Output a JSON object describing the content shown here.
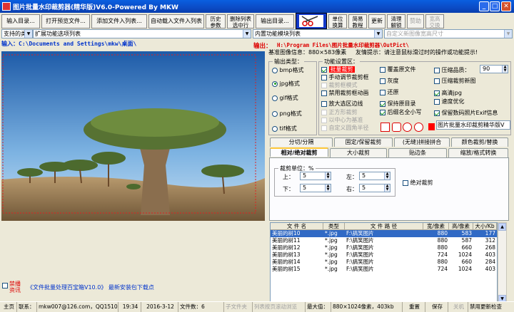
{
  "window": {
    "title": "图片批量水印裁剪器(精华版)V6.0-Powered By MKW"
  },
  "toolbar": {
    "input_dir": "输入目录...",
    "open_preview": "打开预览文件...",
    "add_files": "添加文件入列表...",
    "auto_load": "自动载入文件入列表",
    "history_1": "历史",
    "history_2": "参数",
    "delete_1": "删除列表",
    "delete_2": "选中行",
    "output_dir": "输出目录...",
    "unit_1": "单位",
    "unit_2": "换算",
    "tutorial_1": "简易",
    "tutorial_2": "教程",
    "update": "更新",
    "clear_1": "清理",
    "clear_2": "解锁",
    "donate": "赞助",
    "wh_1": "宽高",
    "wh_2": "交换"
  },
  "selects": {
    "types": "支持的类型",
    "expand_list": "扩展功能选项列表",
    "builtin_list": "内置功能模块列表",
    "custom_size": "自定义新图像宽高尺寸"
  },
  "paths": {
    "input": "输入：C:\\Documents and Settings\\mkw\\桌面\\",
    "output_label": "输出：",
    "output": "H:\\Program Files\\图片批量水印裁剪器\\OutPict\\"
  },
  "info": {
    "base_label": "基准图像信息：",
    "base_size": "880×583像素",
    "tip": "友情提示：请注意鼠标滑过时的操作或功能提示!"
  },
  "output_format": {
    "title": "输出类型：",
    "options": [
      "bmp格式",
      "jpg格式",
      "gif格式",
      "png格式",
      "tif格式"
    ],
    "selected": "jpg格式"
  },
  "function": {
    "title": "功能设置区：",
    "col1": [
      {
        "label": "批量裁剪",
        "checked": true,
        "highlight": true
      },
      {
        "label": "手动调节裁剪框",
        "checked": false
      },
      {
        "label": "裁剪框模式",
        "checked": false,
        "disabled": true
      },
      {
        "label": "禁用裁剪框动画",
        "checked": false
      },
      {
        "label": "放大选区边线",
        "checked": false
      },
      {
        "label": "正方形裁剪",
        "checked": false,
        "disabled": true
      },
      {
        "label": "以中心为基准",
        "checked": false,
        "disabled": true
      },
      {
        "label": "自定义圆角半径",
        "checked": false,
        "disabled": true
      }
    ],
    "col2": [
      {
        "label": "覆盖原文件",
        "checked": false
      },
      {
        "label": "灰度",
        "checked": false
      },
      {
        "label": "还原",
        "checked": false
      },
      {
        "label": "保持原目录",
        "checked": true
      },
      {
        "label": "后缀名全小写",
        "checked": true
      }
    ],
    "col3": [
      {
        "label": "压缩品质：",
        "checked": false
      },
      {
        "label": "压缩裁剪新图",
        "checked": false
      },
      {
        "label": "高清jpg",
        "checked": true
      },
      {
        "label": "速度优化",
        "checked": false
      },
      {
        "label": "保留数码照片Exif信息",
        "checked": true
      }
    ],
    "quality": "90",
    "watermark_text": "图片批量水印裁剪精华版V"
  },
  "tabs_row1": [
    "分切/分隔",
    "固定/保留裁剪",
    "(无缝)拼接拼合",
    "颜色裁剪/替换"
  ],
  "tabs_row2": [
    "相对/绝对裁剪",
    "大小裁剪",
    "贴边条",
    "缩放/格式转换"
  ],
  "crop": {
    "unit_label": "裁剪单位：%",
    "top_label": "上：",
    "top": "5",
    "bottom_label": "下：",
    "bottom": "5",
    "left_label": "左：",
    "left": "5",
    "right_label": "右：",
    "right": "5",
    "absolute": "绝对裁剪"
  },
  "table": {
    "headers": [
      "文 件 名",
      "类型",
      "文 件 路 径",
      "宽/像素",
      "高/像素",
      "大小/Kb"
    ],
    "rows": [
      {
        "name": "美丽的树10",
        "type": "*.jpg",
        "path": "F:\\搞笑图片",
        "w": "880",
        "h": "583",
        "size": "177",
        "selected": true
      },
      {
        "name": "美丽的树11",
        "type": "*.jpg",
        "path": "F:\\搞笑图片",
        "w": "880",
        "h": "587",
        "size": "312"
      },
      {
        "name": "美丽的树12",
        "type": "*.jpg",
        "path": "F:\\搞笑图片",
        "w": "880",
        "h": "660",
        "size": "268"
      },
      {
        "name": "美丽的树13",
        "type": "*.jpg",
        "path": "F:\\搞笑图片",
        "w": "724",
        "h": "1024",
        "size": "403"
      },
      {
        "name": "美丽的树14",
        "type": "*.jpg",
        "path": "F:\\搞笑图片",
        "w": "880",
        "h": "660",
        "size": "284"
      },
      {
        "name": "美丽的树15",
        "type": "*.jpg",
        "path": "F:\\搞笑图片",
        "w": "724",
        "h": "1024",
        "size": "403"
      }
    ]
  },
  "bottom_left": {
    "forbid_1": "禁播",
    "forbid_2": "资讯",
    "promo": "《文件批量处理百宝箱V10.0》 最新安装包下载点"
  },
  "status": {
    "home": "主页",
    "contact_label": "联系：",
    "contact": "mkw007@126.com，QQ15104946",
    "time": "19:34",
    "date": "2016-3-12",
    "count": "文件数：6",
    "sub_file": "子文件夹",
    "scroll_hint": "列表按页滚动浏览",
    "max_label": "最大值：",
    "max_value": "880×1024像素，403kb",
    "reset": "重置",
    "save": "保存",
    "shutdown": "关机",
    "disable_update": "禁用更新检查"
  },
  "colors": {
    "selected_row": "#316AC5",
    "output_text": "#DD0000",
    "input_text": "#0033CC",
    "highlight": "#FF0000"
  }
}
